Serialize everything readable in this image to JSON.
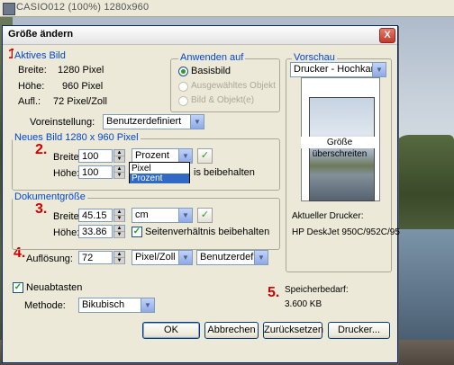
{
  "app_title": "CASIO012 (100%) 1280x960",
  "dialog": {
    "title": "Größe ändern",
    "close_label": "X"
  },
  "markers": [
    "1",
    "2.",
    "3.",
    "4.",
    "5."
  ],
  "aktives_bild": {
    "legend": "Aktives Bild",
    "rows": [
      {
        "label": "Breite:",
        "value": "1280 Pixel"
      },
      {
        "label": "Höhe:",
        "value": "960 Pixel"
      },
      {
        "label": "Aufl.:",
        "value": "72 Pixel/Zoll"
      }
    ]
  },
  "anwenden_auf": {
    "legend": "Anwenden auf",
    "options": [
      {
        "label": "Basisbild",
        "selected": true,
        "enabled": true
      },
      {
        "label": "Ausgewähltes Objekt",
        "selected": false,
        "enabled": false
      },
      {
        "label": "Bild & Objekt(e)",
        "selected": false,
        "enabled": false
      }
    ]
  },
  "voreinstellung": {
    "label": "Voreinstellung:",
    "value": "Benutzerdefiniert"
  },
  "neues_bild": {
    "legend": "Neues Bild 1280 x 960 Pixel",
    "breite_label": "Breite:",
    "breite_value": "100",
    "hoehe_label": "Höhe:",
    "hoehe_value": "100",
    "unit_value": "Prozent",
    "dropdown_options": [
      "Pixel",
      "Prozent"
    ],
    "keep_ratio_tail": "is beibehalten"
  },
  "dokumentgroesse": {
    "legend": "Dokumentgröße",
    "breite_label": "Breite:",
    "breite_value": "45.15",
    "hoehe_label": "Höhe:",
    "hoehe_value": "33.86",
    "unit_value": "cm",
    "keep_ratio_label": "Seitenverhältnis beibehalten"
  },
  "aufloesung": {
    "label": "Auflösung:",
    "value": "72",
    "unit_value": "Pixel/Zoll",
    "preset_value": "Benutzerdefinier"
  },
  "neuabtasten": {
    "label": "Neuabtasten",
    "methode_label": "Methode:",
    "methode_value": "Bikubisch"
  },
  "vorschau": {
    "legend": "Vorschau",
    "select_value": "Drucker - Hochkantfor",
    "warning": "Größe überschreiten",
    "printer_label": "Aktueller Drucker:",
    "printer_name": "HP DeskJet 950C/952C/95"
  },
  "speicher": {
    "label": "Speicherbedarf:",
    "value": "3.600 KB"
  },
  "buttons": {
    "ok": "OK",
    "cancel": "Abbrechen",
    "reset": "Zurücksetzen",
    "printer": "Drucker..."
  }
}
